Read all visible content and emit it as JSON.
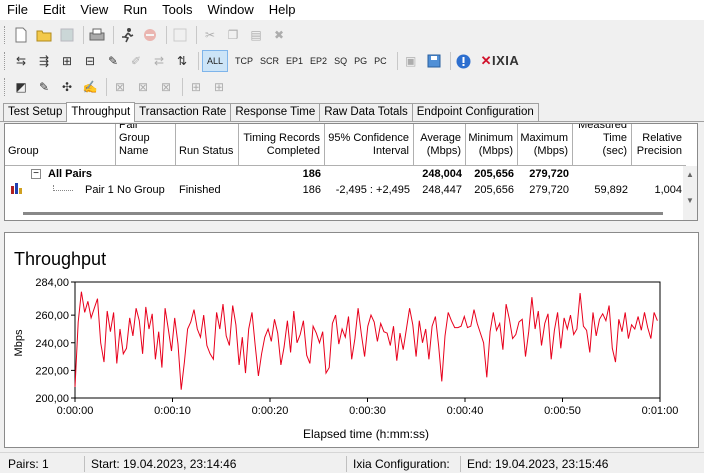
{
  "menu": [
    "File",
    "Edit",
    "View",
    "Run",
    "Tools",
    "Window",
    "Help"
  ],
  "toolbar": {
    "filters": [
      "ALL",
      "TCP",
      "SCR",
      "EP1",
      "EP2",
      "SQ",
      "PG",
      "PC"
    ],
    "brand": "IXIA"
  },
  "tabs": [
    "Test Setup",
    "Throughput",
    "Transaction Rate",
    "Response Time",
    "Raw Data Totals",
    "Endpoint Configuration"
  ],
  "active_tab": "Throughput",
  "table": {
    "headers": {
      "group": "Group",
      "pair_group_name": "Pair Group Name",
      "run_status": "Run Status",
      "timing_records": "Timing Records Completed",
      "confidence": "95% Confidence Interval",
      "average": "Average (Mbps)",
      "minimum": "Minimum (Mbps)",
      "maximum": "Maximum (Mbps)",
      "measured": "Measured Time (sec)",
      "precision": "Relative Precision"
    },
    "rows": [
      {
        "group": "All Pairs",
        "pair_group_name": "",
        "run_status": "",
        "timing_records": "186",
        "confidence": "",
        "average": "248,004",
        "minimum": "205,656",
        "maximum": "279,720",
        "measured": "",
        "precision": ""
      },
      {
        "group": "Pair 1",
        "pair_group_name": "No Group",
        "run_status": "Finished",
        "timing_records": "186",
        "confidence": "-2,495 : +2,495",
        "average": "248,447",
        "minimum": "205,656",
        "maximum": "279,720",
        "measured": "59,892",
        "precision": "1,004"
      }
    ]
  },
  "chart_data": {
    "type": "line",
    "title": "Throughput",
    "xlabel": "Elapsed time (h:mm:ss)",
    "ylabel": "Mbps",
    "ylim": [
      200,
      284
    ],
    "yticks": [
      "200,00",
      "220,00",
      "240,00",
      "260,00",
      "284,00"
    ],
    "ytick_values": [
      200,
      220,
      240,
      260,
      284
    ],
    "xticks": [
      "0:00:00",
      "0:00:10",
      "0:00:20",
      "0:00:30",
      "0:00:40",
      "0:00:50",
      "0:01:00"
    ],
    "xlim_seconds": [
      0,
      60
    ],
    "grid": false,
    "line_color": "#e8001c",
    "series": [
      {
        "x": [
          0,
          0.33,
          0.66,
          0.99,
          1.32,
          1.65,
          1.98,
          2.31,
          2.64,
          2.97,
          3.3,
          3.63,
          3.96,
          4.29,
          4.62,
          4.95,
          5.28,
          5.61,
          5.94,
          6.27,
          6.6,
          6.93,
          7.26,
          7.59,
          7.92,
          8.25,
          8.58,
          8.91,
          9.24,
          9.57,
          9.9,
          10.23,
          10.56,
          10.89,
          11.22,
          11.55,
          11.88,
          12.21,
          12.54,
          12.87,
          13.2,
          13.53,
          13.86,
          14.19,
          14.52,
          14.85,
          15.18,
          15.51,
          15.84,
          16.17,
          16.5,
          16.83,
          17.16,
          17.49,
          17.82,
          18.15,
          18.48,
          18.81,
          19.14,
          19.47,
          19.8,
          20.13,
          20.46,
          20.79,
          21.12,
          21.45,
          21.78,
          22.11,
          22.44,
          22.77,
          23.1,
          23.43,
          23.76,
          24.09,
          24.42,
          24.75,
          25.08,
          25.41,
          25.74,
          26.07,
          26.4,
          26.73,
          27.06,
          27.39,
          27.72,
          28.05,
          28.38,
          28.71,
          29.04,
          29.37,
          29.7,
          30.03,
          30.36,
          30.69,
          31.02,
          31.35,
          31.68,
          32.01,
          32.34,
          32.67,
          33,
          33.33,
          33.66,
          33.99,
          34.32,
          34.65,
          34.98,
          35.31,
          35.64,
          35.97,
          36.3,
          36.63,
          36.96,
          37.29,
          37.62,
          37.95,
          38.28,
          38.61,
          38.94,
          39.27,
          39.6,
          39.93,
          40.26,
          40.59,
          40.92,
          41.25,
          41.58,
          41.91,
          42.24,
          42.57,
          42.9,
          43.23,
          43.56,
          43.89,
          44.22,
          44.55,
          44.88,
          45.21,
          45.54,
          45.87,
          46.2,
          46.53,
          46.86,
          47.19,
          47.52,
          47.85,
          48.18,
          48.51,
          48.84,
          49.17,
          49.5,
          49.83,
          50.16,
          50.49,
          50.82,
          51.15,
          51.48,
          51.81,
          52.14,
          52.47,
          52.8,
          53.13,
          53.46,
          53.79,
          54.12,
          54.45,
          54.78,
          55.11,
          55.44,
          55.77,
          56.1,
          56.43,
          56.76,
          57.09,
          57.42,
          57.75,
          58.08,
          58.41,
          58.74,
          59.07,
          59.4,
          59.73
        ],
        "values": [
          208,
          255,
          277,
          262,
          270,
          258,
          265,
          272,
          240,
          226,
          263,
          248,
          262,
          225,
          250,
          232,
          236,
          258,
          245,
          265,
          256,
          232,
          266,
          250,
          261,
          228,
          248,
          222,
          265,
          250,
          234,
          258,
          239,
          206,
          226,
          250,
          255,
          264,
          250,
          244,
          260,
          238,
          232,
          228,
          262,
          250,
          268,
          245,
          238,
          267,
          253,
          224,
          244,
          218,
          250,
          262,
          238,
          216,
          232,
          244,
          250,
          241,
          257,
          247,
          224,
          237,
          256,
          233,
          263,
          240,
          246,
          256,
          231,
          225,
          252,
          247,
          240,
          248,
          218,
          222,
          254,
          260,
          239,
          250,
          244,
          259,
          228,
          243,
          265,
          246,
          230,
          252,
          260,
          255,
          241,
          254,
          248,
          247,
          238,
          252,
          227,
          247,
          235,
          250,
          265,
          253,
          230,
          256,
          240,
          250,
          228,
          252,
          259,
          238,
          212,
          245,
          262,
          256,
          251,
          251,
          252,
          259,
          251,
          252,
          264,
          254,
          247,
          240,
          215,
          248,
          262,
          249,
          254,
          235,
          268,
          257,
          243,
          246,
          255,
          257,
          230,
          248,
          273,
          250,
          263,
          238,
          254,
          261,
          228,
          249,
          262,
          236,
          258,
          250,
          260,
          246,
          250,
          276,
          252,
          249,
          233,
          262,
          245,
          257,
          261,
          256,
          267,
          236,
          226,
          257,
          248,
          262,
          243,
          253,
          250,
          259,
          249,
          262,
          251,
          243,
          262,
          256
        ]
      }
    ]
  },
  "status": {
    "pairs": "Pairs: 1",
    "start": "Start: 19.04.2023, 23:14:46",
    "config": "Ixia Configuration:",
    "end": "End: 19.04.2023, 23:15:46"
  }
}
